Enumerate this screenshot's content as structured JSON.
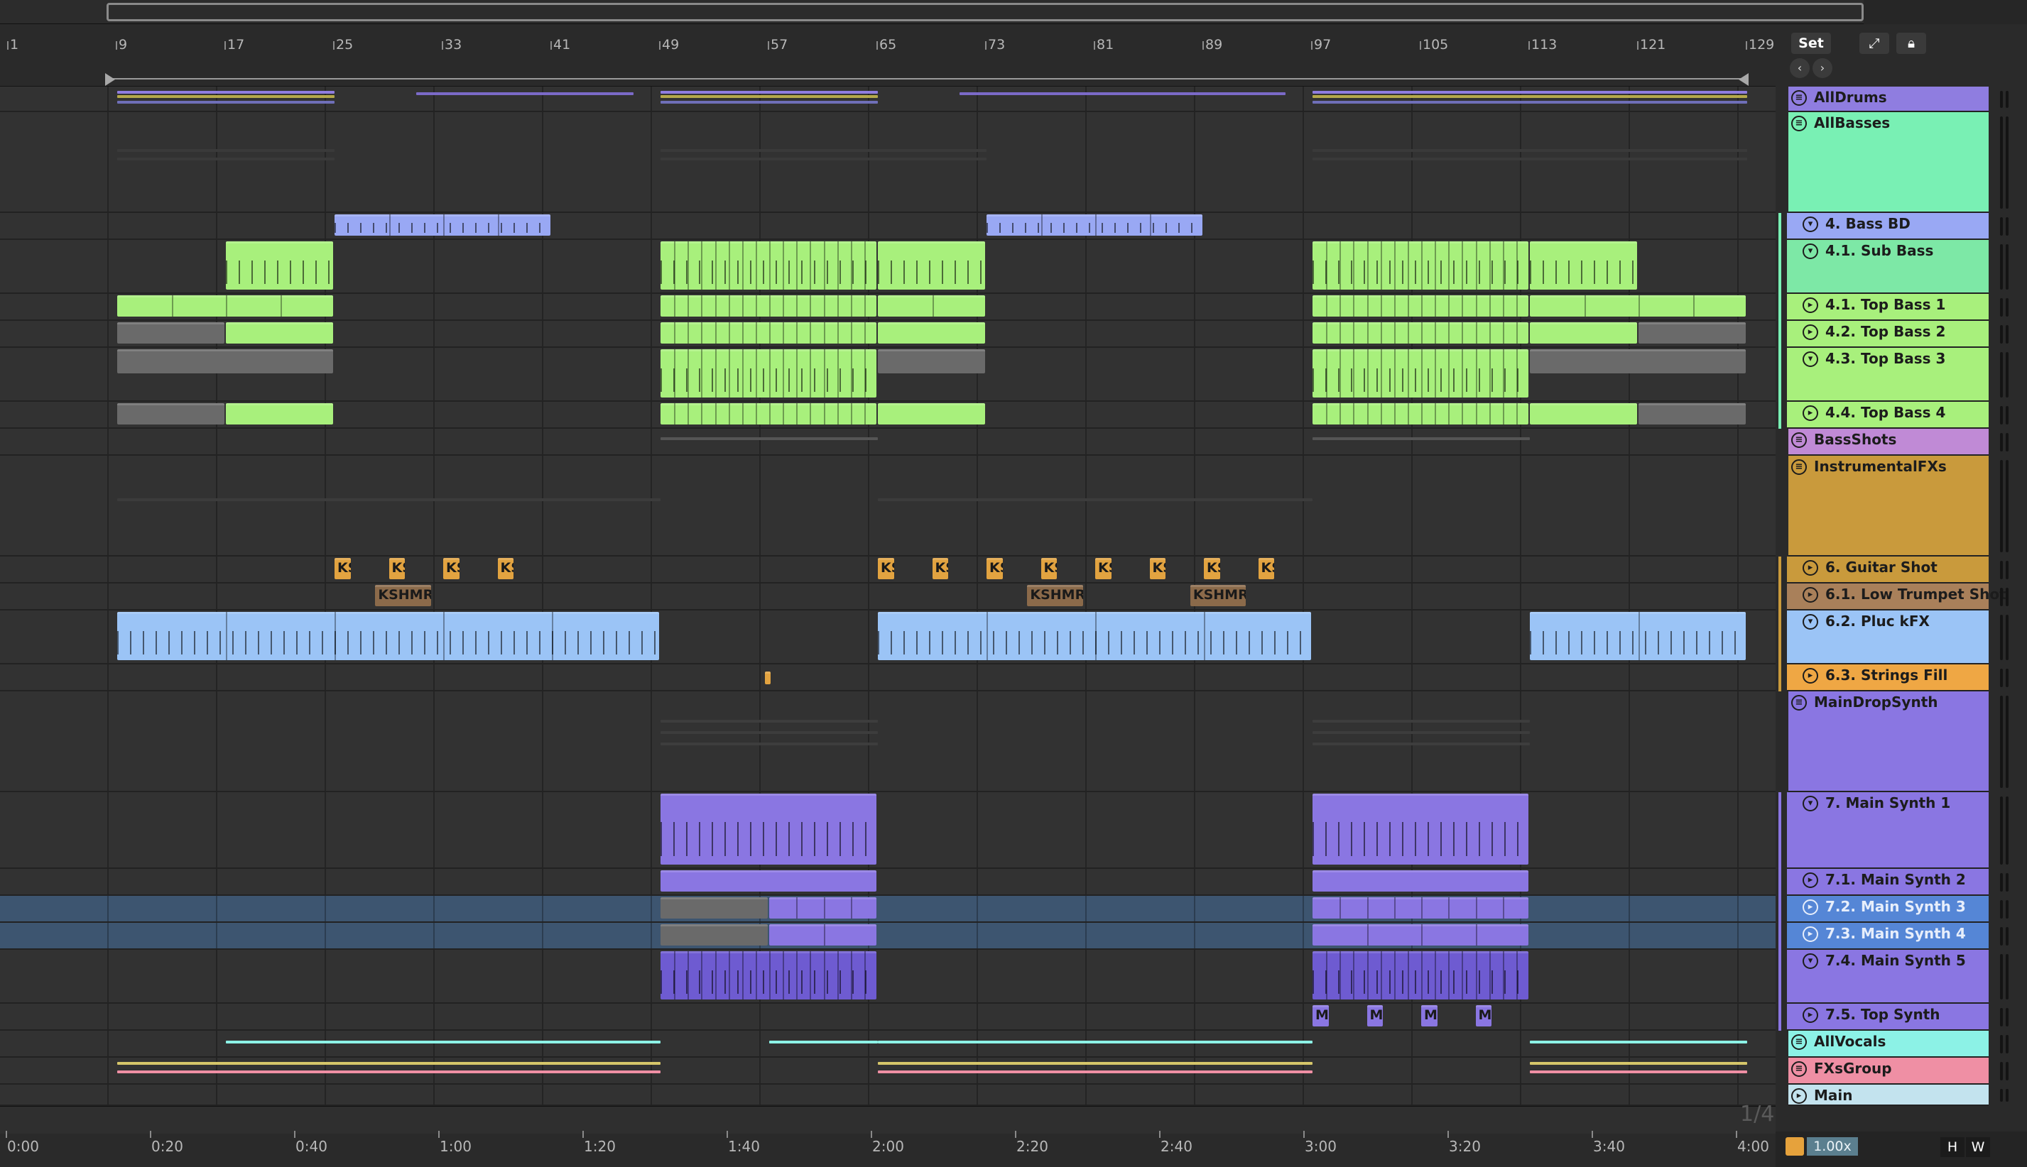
{
  "ruler": {
    "bars": [
      "1",
      "9",
      "17",
      "25",
      "33",
      "41",
      "49",
      "57",
      "65",
      "73",
      "81",
      "89",
      "97",
      "105",
      "113",
      "121",
      "129"
    ]
  },
  "time_ruler": {
    "labels": [
      "0:00",
      "0:20",
      "0:40",
      "1:00",
      "1:20",
      "1:40",
      "2:00",
      "2:20",
      "2:40",
      "3:00",
      "3:20",
      "3:40",
      "4:00"
    ]
  },
  "grid": {
    "fraction": "1/4"
  },
  "toolbar": {
    "set_label": "Set",
    "expand_icon": "expand-icon",
    "lock_icon": "lock-icon",
    "prev_icon": "arrow-left-icon",
    "next_icon": "arrow-right-icon"
  },
  "tracks": [
    {
      "name": "AllDrums",
      "kind": "group",
      "color": "#8f7de0"
    },
    {
      "name": "AllBasses",
      "kind": "group",
      "color": "#79f0b4"
    },
    {
      "name": "4. Bass BD",
      "kind": "sub",
      "color": "#99a8f4"
    },
    {
      "name": "4.1. Sub Bass",
      "kind": "sub",
      "color": "#7de8a6"
    },
    {
      "name": "4.1. Top Bass 1",
      "kind": "track",
      "color": "#a8f07c"
    },
    {
      "name": "4.2. Top Bass 2",
      "kind": "track",
      "color": "#a8f07c"
    },
    {
      "name": "4.3. Top Bass 3",
      "kind": "sub",
      "color": "#a8f07c"
    },
    {
      "name": "4.4. Top Bass 4",
      "kind": "track",
      "color": "#a8f07c"
    },
    {
      "name": "BassShots",
      "kind": "group",
      "color": "#c08ad6"
    },
    {
      "name": "InstrumentalFXs",
      "kind": "group",
      "color": "#c99a3c"
    },
    {
      "name": "6. Guitar Shot",
      "kind": "track",
      "color": "#c99a3c"
    },
    {
      "name": "6.1. Low Trumpet Shot",
      "kind": "track",
      "color": "#a9805a"
    },
    {
      "name": "6.2. Pluc kFX",
      "kind": "sub",
      "color": "#9bc4f6"
    },
    {
      "name": "6.3. Strings Fill",
      "kind": "track",
      "color": "#efa744"
    },
    {
      "name": "MainDropSynth",
      "kind": "group",
      "color": "#8a76e2"
    },
    {
      "name": "7. Main Synth 1",
      "kind": "sub",
      "color": "#8a76e2"
    },
    {
      "name": "7.1. Main Synth 2",
      "kind": "track",
      "color": "#8a76e2"
    },
    {
      "name": "7.2. Main Synth 3",
      "kind": "track",
      "color": "#5586d6",
      "selected": true
    },
    {
      "name": "7.3. Main Synth 4",
      "kind": "track",
      "color": "#5586d6",
      "selected": true
    },
    {
      "name": "7.4. Main Synth 5",
      "kind": "sub",
      "color": "#8a76e2"
    },
    {
      "name": "7.5. Top Synth",
      "kind": "track",
      "color": "#8a76e2"
    },
    {
      "name": "AllVocals",
      "kind": "group",
      "color": "#8cf2e6"
    },
    {
      "name": "FXsGroup",
      "kind": "group",
      "color": "#ef8fa4"
    },
    {
      "name": "Main",
      "kind": "main",
      "color": "#c3e3ee"
    }
  ],
  "clip_labels": {
    "ks": "KS",
    "kshmr": "KSHMR",
    "m": "M"
  },
  "bottom": {
    "zoom": "1.00x",
    "h_key": "H",
    "w_key": "W",
    "cpu_icon": "cpu-icon"
  }
}
